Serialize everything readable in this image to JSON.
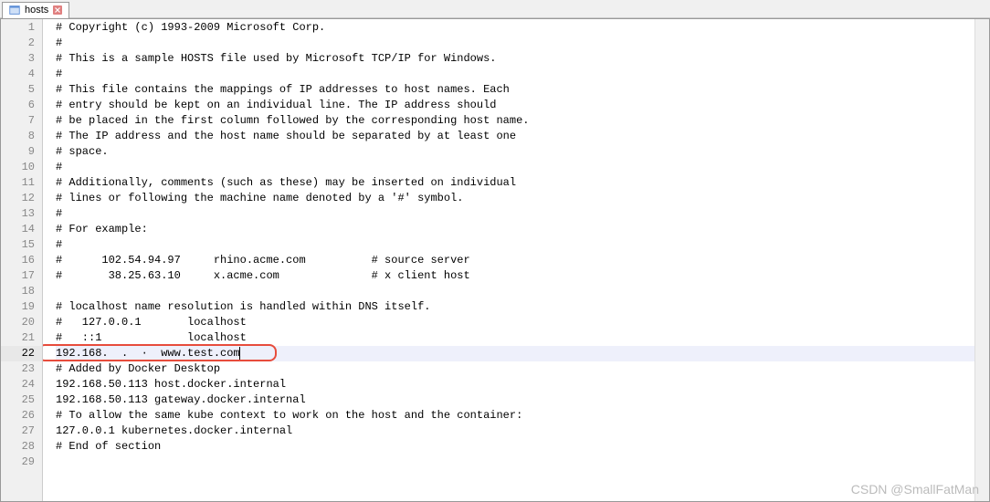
{
  "tab": {
    "label": "hosts"
  },
  "editor": {
    "current_line": 22,
    "lines": [
      "# Copyright (c) 1993-2009 Microsoft Corp.",
      "#",
      "# This is a sample HOSTS file used by Microsoft TCP/IP for Windows.",
      "#",
      "# This file contains the mappings of IP addresses to host names. Each",
      "# entry should be kept on an individual line. The IP address should",
      "# be placed in the first column followed by the corresponding host name.",
      "# The IP address and the host name should be separated by at least one",
      "# space.",
      "#",
      "# Additionally, comments (such as these) may be inserted on individual",
      "# lines or following the machine name denoted by a '#' symbol.",
      "#",
      "# For example:",
      "#",
      "#      102.54.94.97     rhino.acme.com          # source server",
      "#       38.25.63.10     x.acme.com              # x client host",
      "",
      "# localhost name resolution is handled within DNS itself.",
      "#   127.0.0.1       localhost",
      "#   ::1             localhost",
      "192.168.  .  ·  www.test.com",
      "# Added by Docker Desktop",
      "192.168.50.113 host.docker.internal",
      "192.168.50.113 gateway.docker.internal",
      "# To allow the same kube context to work on the host and the container:",
      "127.0.0.1 kubernetes.docker.internal",
      "# End of section",
      ""
    ]
  },
  "watermark": "CSDN @SmallFatMan"
}
